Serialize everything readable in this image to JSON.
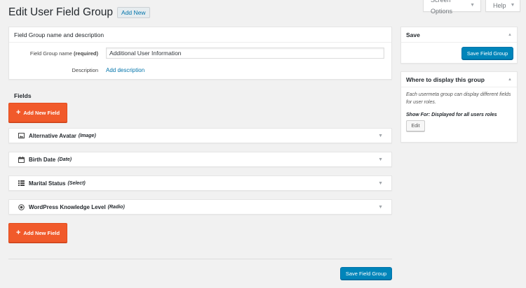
{
  "screen_meta": {
    "screen_options": "Screen Options",
    "help": "Help"
  },
  "page": {
    "title": "Edit User Field Group",
    "add_new": "Add New"
  },
  "name_box": {
    "title": "Field Group name and description",
    "name_label": "Field Group name",
    "name_required": "(required)",
    "name_value": "Additional User Information",
    "description_label": "Description",
    "description_link": "Add description"
  },
  "fields": {
    "heading": "Fields",
    "add_button_label": "Add New Field",
    "items": [
      {
        "name": "Alternative Avatar",
        "type": "(Image)",
        "icon": "image-icon"
      },
      {
        "name": "Birth Date",
        "type": "(Date)",
        "icon": "calendar-icon"
      },
      {
        "name": "Marital Status",
        "type": "(Select)",
        "icon": "select-list-icon"
      },
      {
        "name": "WordPress Knowledge Level",
        "type": "(Radio)",
        "icon": "radio-icon"
      }
    ]
  },
  "save_bottom": "Save Field Group",
  "save_box": {
    "title": "Save",
    "button": "Save Field Group"
  },
  "display_box": {
    "title": "Where to display this group",
    "description": "Each usermeta group can display different fields for user roles.",
    "show_for_label": "Show For:",
    "show_for_value": "Displayed for all users roles",
    "edit_button": "Edit"
  },
  "colors": {
    "accent_orange": "#f15a2b",
    "primary_blue": "#0085ba",
    "link_blue": "#0073aa",
    "background": "#f1f1f1"
  }
}
